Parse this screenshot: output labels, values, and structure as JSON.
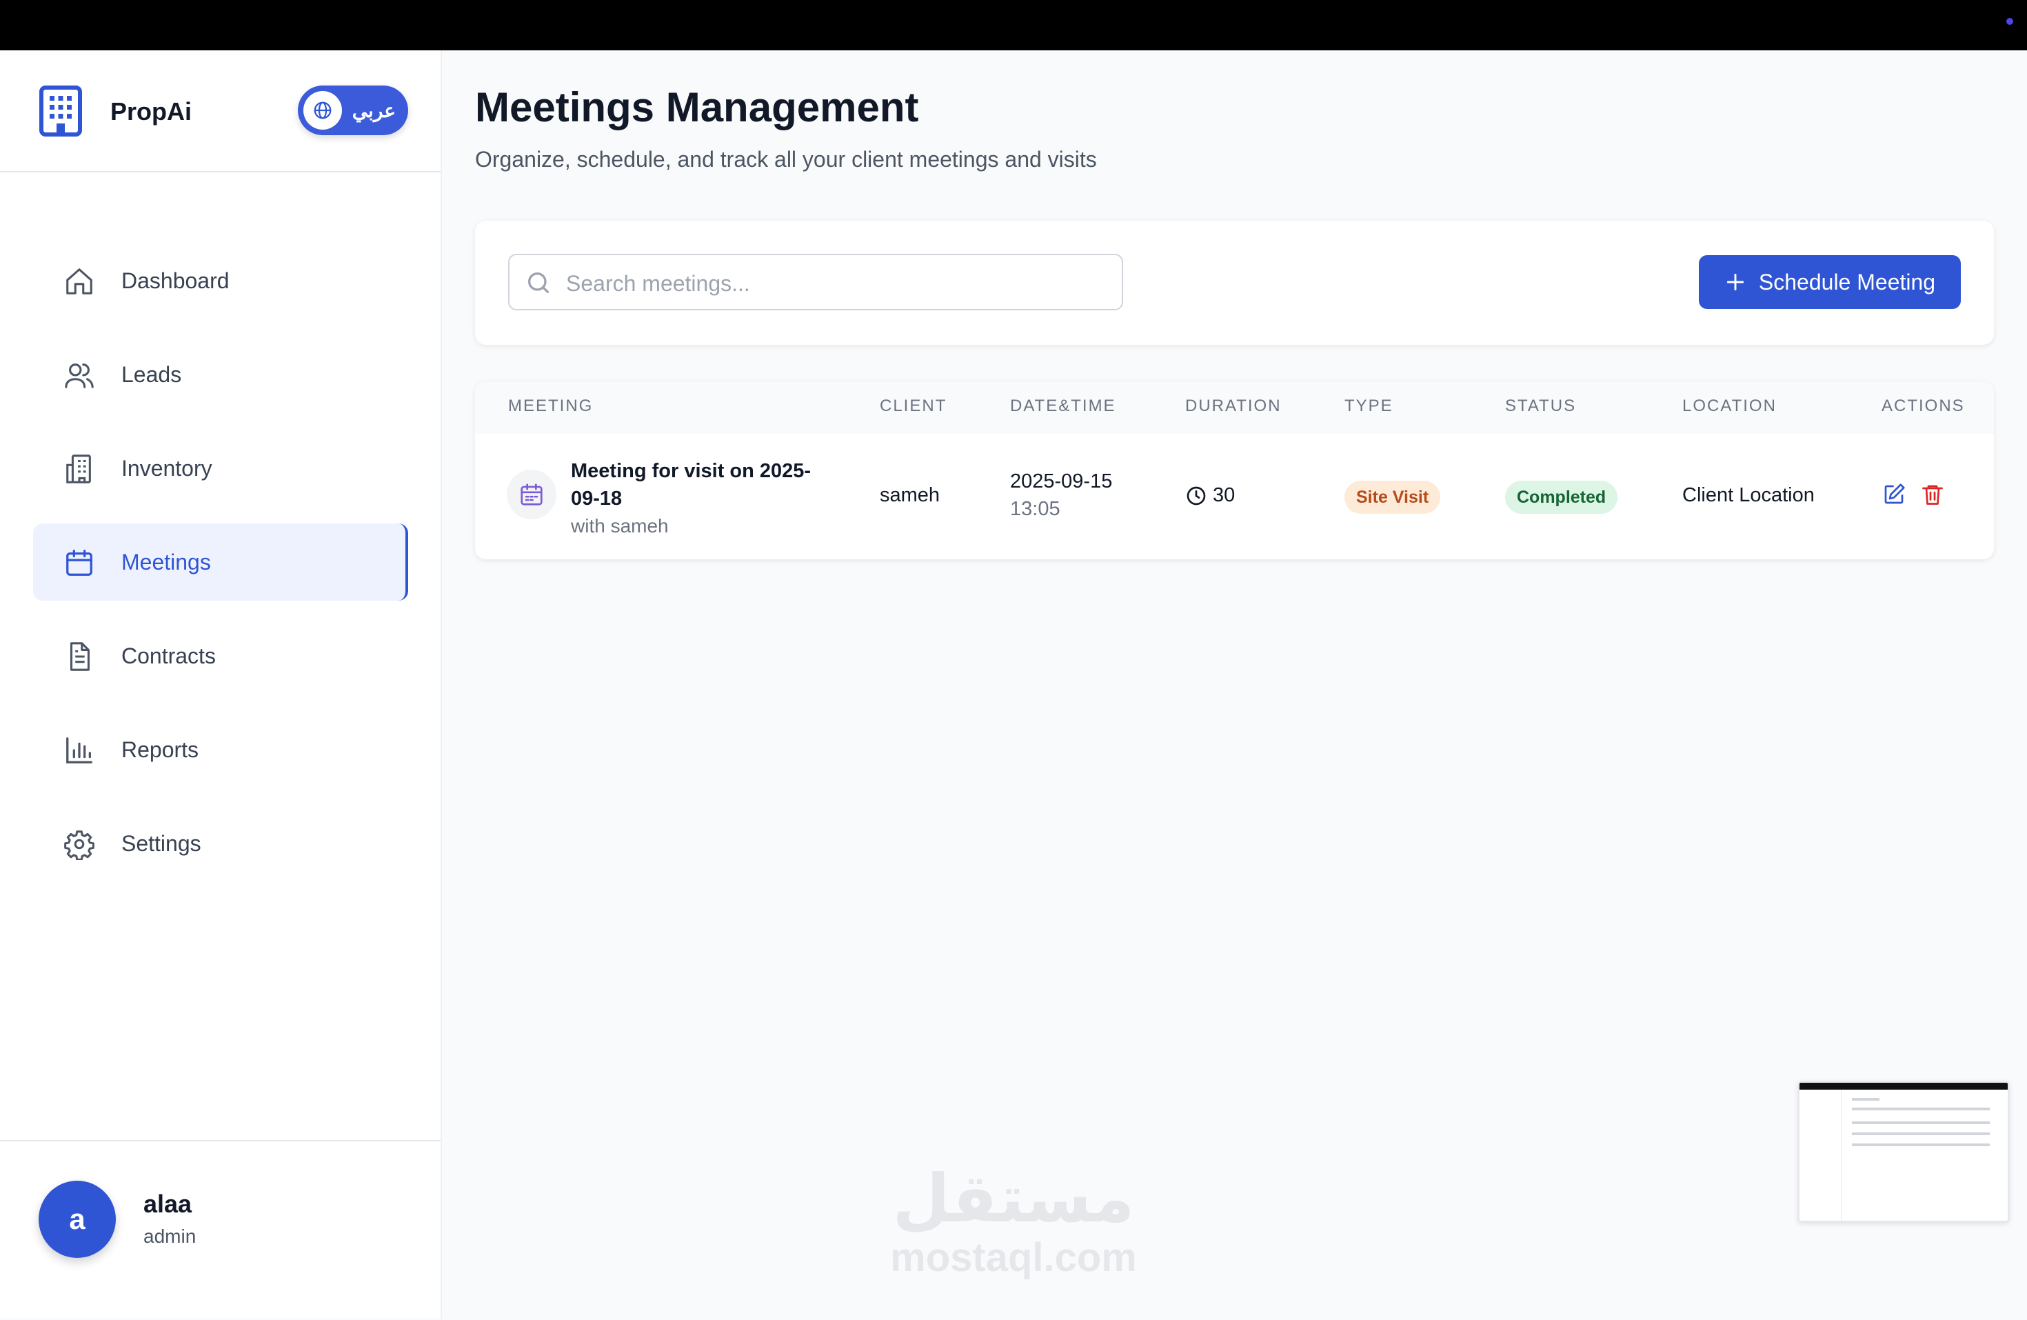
{
  "brand": {
    "name": "PropAi",
    "lang_toggle_label": "عربي"
  },
  "nav": {
    "items": [
      {
        "label": "Dashboard",
        "icon": "home-icon"
      },
      {
        "label": "Leads",
        "icon": "users-icon"
      },
      {
        "label": "Inventory",
        "icon": "building-icon"
      },
      {
        "label": "Meetings",
        "icon": "calendar-icon",
        "active": true
      },
      {
        "label": "Contracts",
        "icon": "document-icon"
      },
      {
        "label": "Reports",
        "icon": "bar-chart-icon"
      },
      {
        "label": "Settings",
        "icon": "gear-icon"
      }
    ]
  },
  "user": {
    "initial": "a",
    "name": "alaa",
    "role": "admin"
  },
  "page": {
    "title": "Meetings Management",
    "subtitle": "Organize, schedule, and track all your client meetings and visits"
  },
  "search": {
    "placeholder": "Search meetings...",
    "value": ""
  },
  "toolbar": {
    "schedule_label": "Schedule Meeting"
  },
  "table": {
    "columns": [
      "MEETING",
      "CLIENT",
      "DATE&TIME",
      "DURATION",
      "TYPE",
      "STATUS",
      "LOCATION",
      "ACTIONS"
    ],
    "rows": [
      {
        "title": "Meeting for visit on 2025-09-18",
        "with": "with sameh",
        "client": "sameh",
        "date": "2025-09-15",
        "time": "13:05",
        "duration": "30",
        "type": "Site Visit",
        "status": "Completed",
        "location": "Client Location"
      }
    ]
  },
  "watermark": {
    "arabic": "مستقل",
    "latin": "mostaql.com"
  },
  "colors": {
    "primary": "#2f55d4",
    "type_badge_bg": "#fdebd7",
    "type_badge_fg": "#b54a1a",
    "status_badge_bg": "#dcf5e4",
    "status_badge_fg": "#166534",
    "delete": "#dc2626"
  }
}
